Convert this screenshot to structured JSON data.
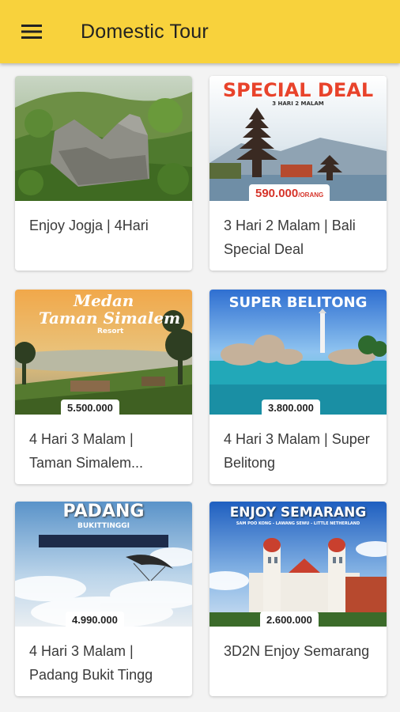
{
  "appbar": {
    "title": "Domestic Tour",
    "menu_icon": "hamburger-menu-icon"
  },
  "colors": {
    "appbar": "#f8d23c",
    "background": "#f3f3f3",
    "card": "#ffffff"
  },
  "tours": [
    {
      "label": "Enjoy Jogja | 4Hari",
      "banner_title": "",
      "banner_subtitle": "",
      "price": ""
    },
    {
      "label": "3 Hari 2 Malam | Bali Special Deal",
      "banner_title": "SPECIAL DEAL",
      "banner_subtitle": "3 HARI 2 MALAM",
      "price": "590.000",
      "price_unit": "/ORANG"
    },
    {
      "label": "4 Hari 3 Malam | Taman Simalem...",
      "banner_title": "Medan",
      "banner_subtitle": "Taman Simalem",
      "banner_extra": "Resort",
      "price": "5.500.000"
    },
    {
      "label": "4 Hari 3 Malam | Super Belitong",
      "banner_title": "SUPER BELITONG",
      "banner_subtitle": "",
      "price": "3.800.000"
    },
    {
      "label": "4 Hari 3 Malam | Padang Bukit Tingg",
      "banner_title": "PADANG",
      "banner_subtitle": "BUKITTINGGI",
      "price": "4.990.000"
    },
    {
      "label": "3D2N Enjoy Semarang",
      "banner_title": "ENJOY SEMARANG",
      "banner_subtitle": "SAM POO KONG - LAWANG SEWU - LITTLE NETHERLAND",
      "price": "2.600.000"
    }
  ]
}
